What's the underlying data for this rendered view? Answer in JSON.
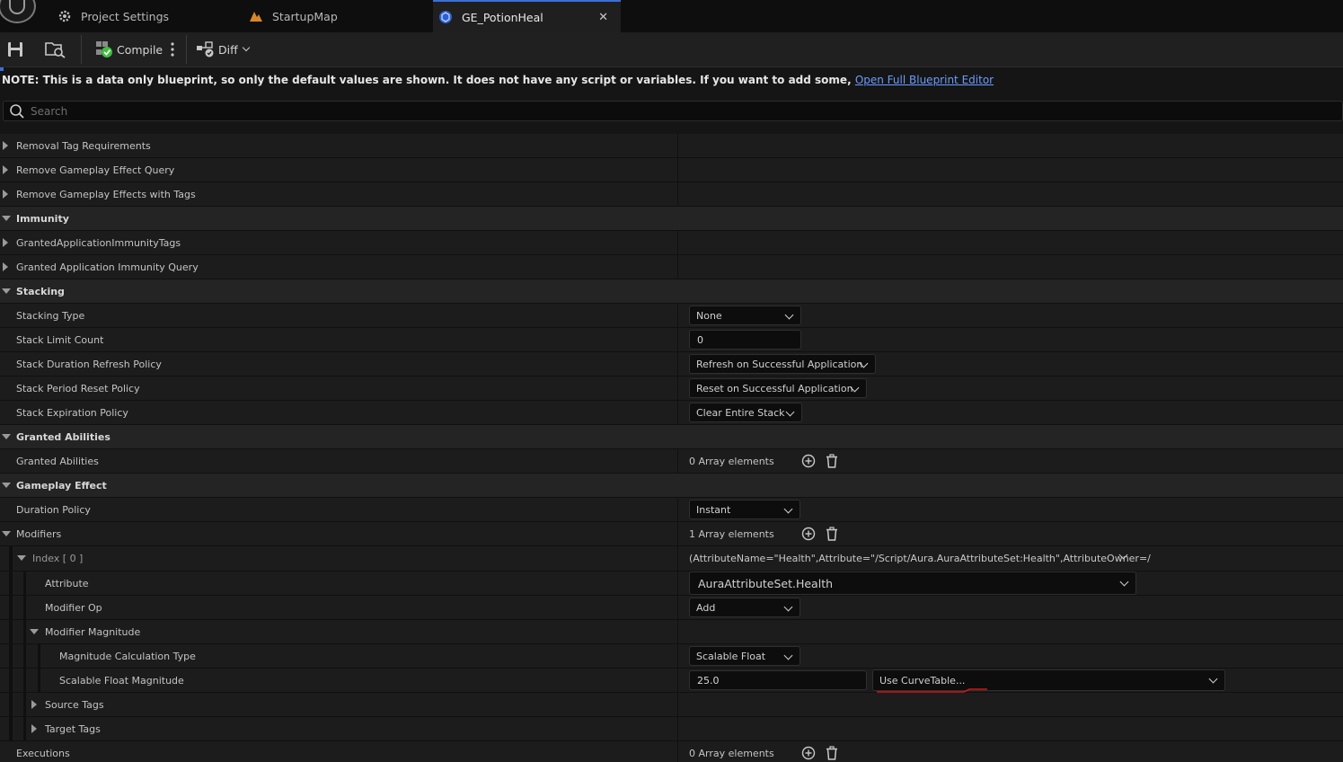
{
  "tabs": [
    {
      "label": "Project Settings",
      "icon": "settings-gear-icon"
    },
    {
      "label": "StartupMap",
      "icon": "level-map-icon"
    },
    {
      "label": "GE_PotionHeal",
      "icon": "blueprint-icon",
      "active": true
    }
  ],
  "toolbar": {
    "compile_label": "Compile",
    "diff_label": "Diff"
  },
  "note": {
    "text": "NOTE: This is a data only blueprint, so only the default values are shown.  It does not have any script or variables.  If you want to add some,",
    "link": "Open Full Blueprint Editor"
  },
  "search": {
    "placeholder": "Search"
  },
  "rows": {
    "removal_tag_requirements": "Removal Tag Requirements",
    "remove_ge_query": "Remove Gameplay Effect Query",
    "remove_ge_with_tags": "Remove Gameplay Effects with Tags",
    "immunity": "Immunity",
    "granted_app_immunity_tags": "GrantedApplicationImmunityTags",
    "granted_app_immunity_query": "Granted Application Immunity Query",
    "stacking": "Stacking",
    "stacking_type": "Stacking Type",
    "stack_limit_count": "Stack Limit Count",
    "stack_duration_refresh_policy": "Stack Duration Refresh Policy",
    "stack_period_reset_policy": "Stack Period Reset Policy",
    "stack_expiration_policy": "Stack Expiration Policy",
    "granted_abilities_cat": "Granted Abilities",
    "granted_abilities": "Granted Abilities",
    "gameplay_effect": "Gameplay Effect",
    "duration_policy": "Duration Policy",
    "modifiers": "Modifiers",
    "index0": "Index [ 0 ]",
    "attribute": "Attribute",
    "modifier_op": "Modifier Op",
    "modifier_magnitude": "Modifier Magnitude",
    "magnitude_calc_type": "Magnitude Calculation Type",
    "scalable_float_magnitude": "Scalable Float Magnitude",
    "source_tags": "Source Tags",
    "target_tags": "Target Tags",
    "executions": "Executions"
  },
  "values": {
    "stacking_type": "None",
    "stack_limit_count": "0",
    "stack_duration_refresh_policy": "Refresh on Successful Application",
    "stack_period_reset_policy": "Reset on Successful Application",
    "stack_expiration_policy": "Clear Entire Stack",
    "granted_abilities_count": "0 Array elements",
    "duration_policy": "Instant",
    "modifiers_count": "1 Array elements",
    "index0_value": "(AttributeName=\"Health\",Attribute=\"/Script/Aura.AuraAttributeSet:Health\",AttributeOwner=/",
    "attribute": "AuraAttributeSet.Health",
    "modifier_op": "Add",
    "magnitude_calc_type": "Scalable Float",
    "scalable_float_value": "25.0",
    "curve_table": "Use CurveTable...",
    "executions_count": "0 Array elements"
  },
  "colors": {
    "accent": "#3b6fd8",
    "link": "#6c9bff",
    "annotation": "#d01818",
    "compile_ok": "#3fbf3f"
  }
}
